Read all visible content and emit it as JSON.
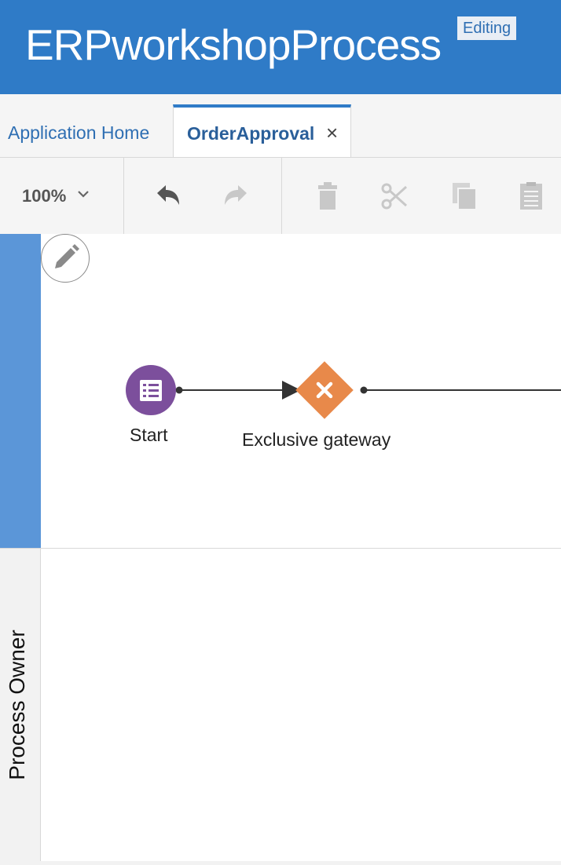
{
  "header": {
    "title": "ERPworkshopProcess",
    "status_badge": "Editing"
  },
  "tabs": {
    "home_label": "Application Home",
    "active_label": "OrderApproval",
    "close_glyph": "×"
  },
  "toolbar": {
    "zoom_value": "100%",
    "icons": [
      "chevron-down-icon",
      "undo-icon",
      "redo-icon",
      "delete-icon",
      "cut-icon",
      "copy-icon",
      "paste-icon"
    ]
  },
  "canvas": {
    "lanes": [
      {
        "label": "",
        "color": "#5b96d8"
      },
      {
        "label": "Process Owner",
        "color": "#f2f2f2"
      }
    ],
    "nodes": [
      {
        "type": "start-form-event",
        "label": "Start",
        "color": "#7c4f9c"
      },
      {
        "type": "exclusive-gateway",
        "label": "Exclusive gateway",
        "color": "#e8894a"
      }
    ]
  },
  "colors": {
    "header": "#2f7bc7",
    "accent": "#2f6fb3",
    "lane_header_active": "#5b96d8"
  }
}
